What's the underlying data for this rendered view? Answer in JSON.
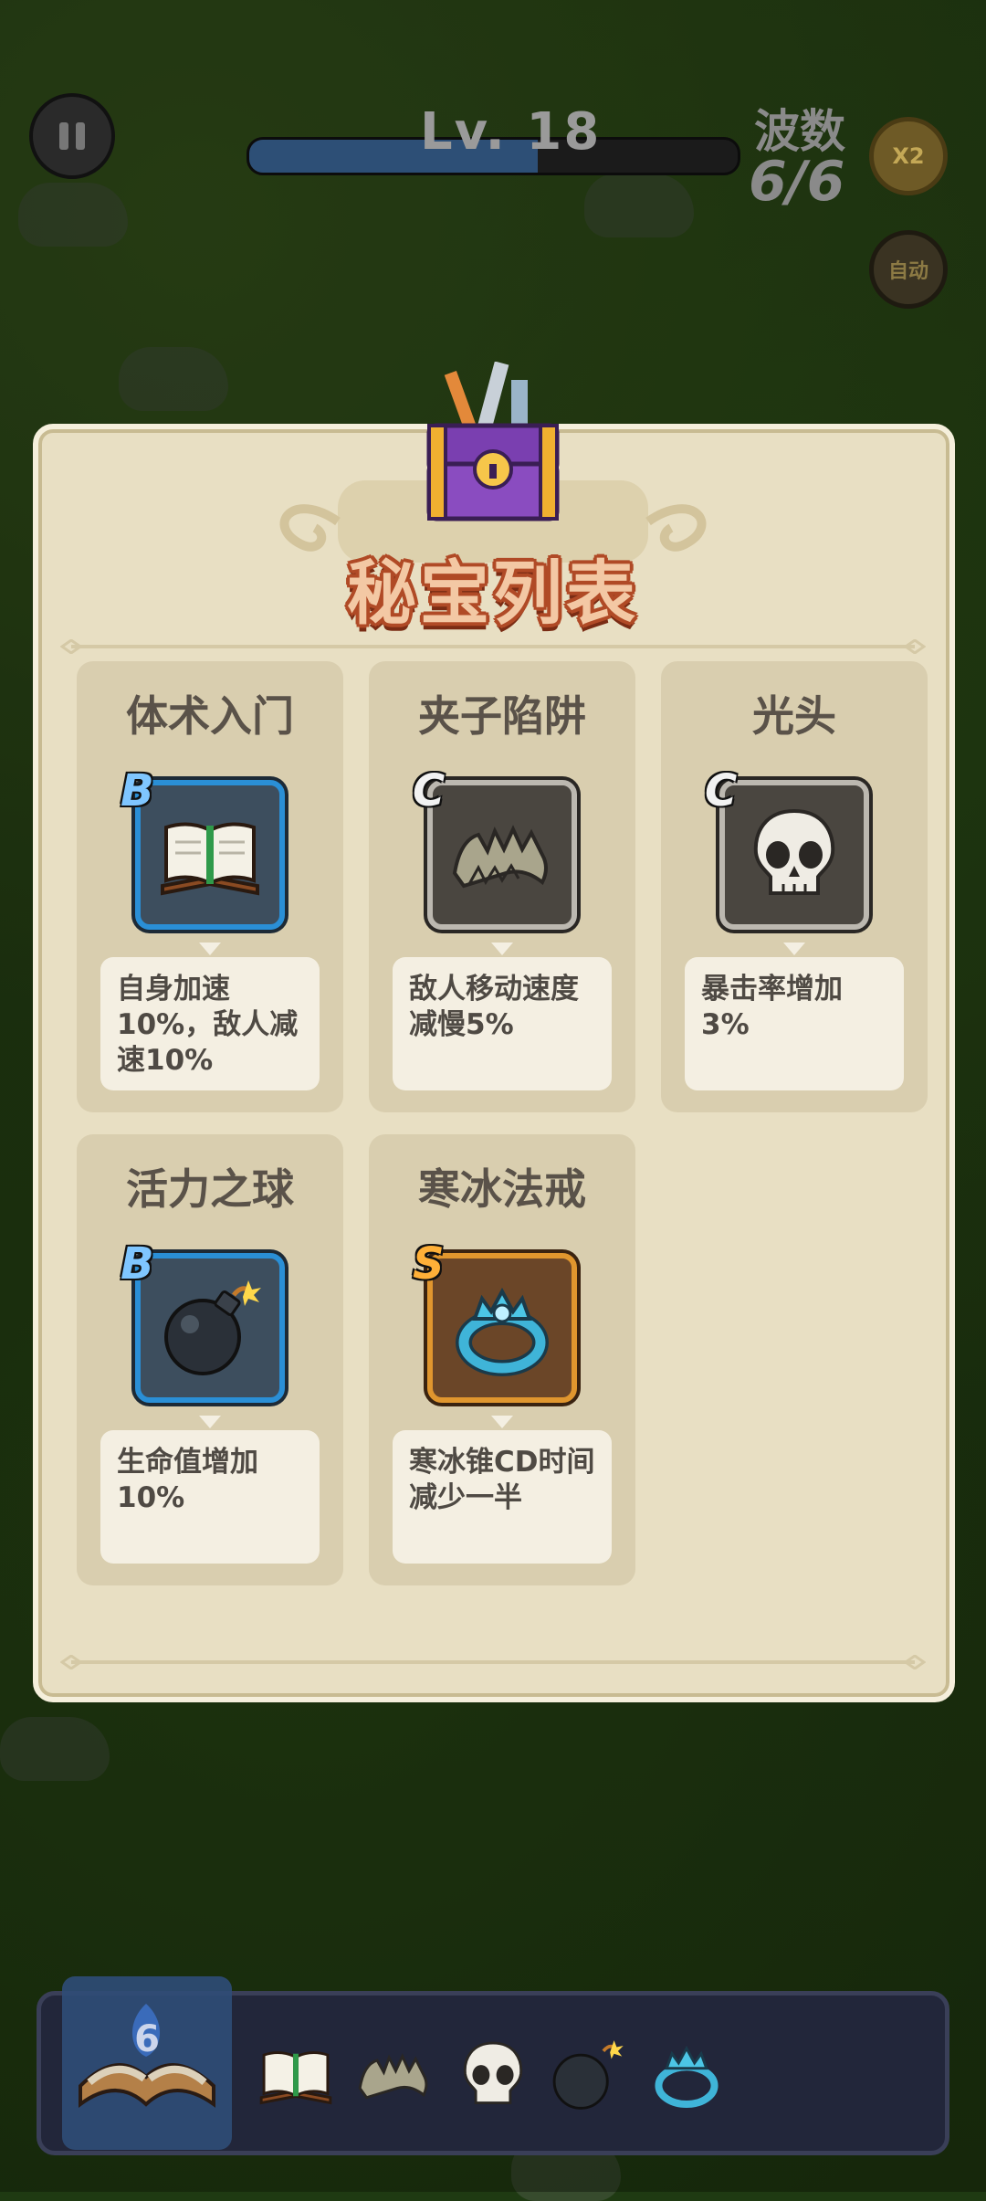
{
  "hud": {
    "level_label": "Lv. 18",
    "level_progress": 0.59,
    "wave_label": "波数",
    "wave_value": "6/6",
    "speed_button": "X2",
    "auto_button": "自动"
  },
  "panel": {
    "title": "秘宝列表",
    "treasures": [
      {
        "name": "体术入门",
        "rank": "B",
        "icon": "book-icon",
        "description": "自身加速10%，敌人减速10%"
      },
      {
        "name": "夹子陷阱",
        "rank": "C",
        "icon": "jaw-trap-icon",
        "description": "敌人移动速度减慢5%"
      },
      {
        "name": "光头",
        "rank": "C",
        "icon": "skull-icon",
        "description": "暴击率增加3%"
      },
      {
        "name": "活力之球",
        "rank": "B",
        "icon": "bomb-icon",
        "description": "生命值增加10%"
      },
      {
        "name": "寒冰法戒",
        "rank": "S",
        "icon": "ice-ring-icon",
        "description": "寒冰锥CD时间减少一半"
      }
    ]
  },
  "bottom_bar": {
    "hero_level": "6",
    "items": [
      "book-icon",
      "jaw-trap-icon",
      "skull-icon",
      "bomb-icon",
      "ice-ring-icon"
    ]
  },
  "colors": {
    "title_fill": "#f3c8a4",
    "title_outline": "#b04a26",
    "panel_bg": "#e8dfc3",
    "rank_b": "#2a8fd6",
    "rank_c": "#bcb8b0",
    "rank_s": "#e0962e"
  }
}
